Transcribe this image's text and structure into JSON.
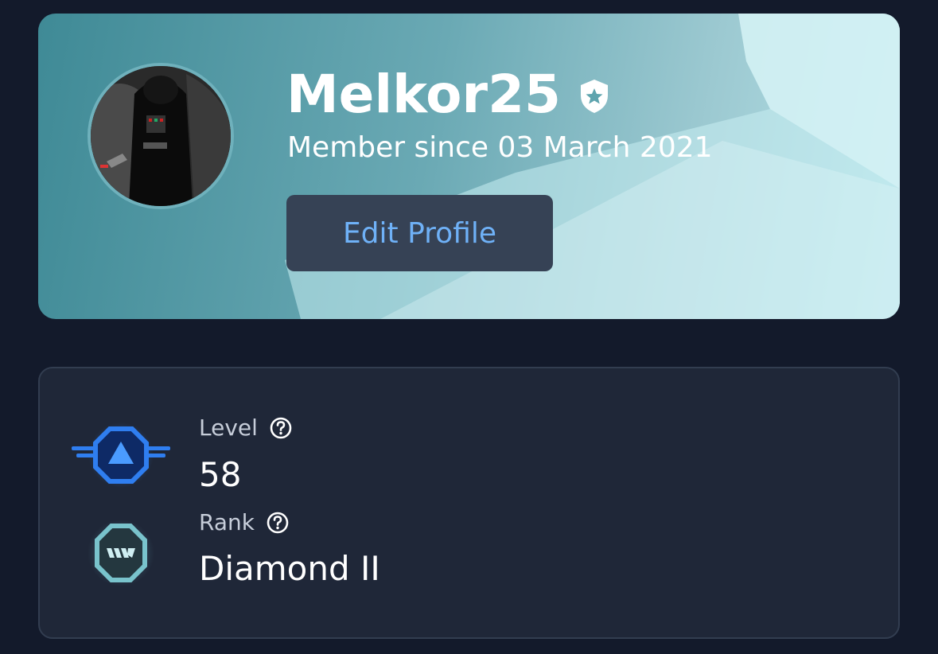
{
  "profile": {
    "username": "Melkor25",
    "member_since": "Member since 03 March 2021",
    "edit_button_label": "Edit Profile",
    "avatar_icon": "dark-helmet-avatar",
    "verified_icon": "shield-star-icon"
  },
  "stats": {
    "level": {
      "label": "Level",
      "value": "58",
      "icon": "level-chevron-badge-icon",
      "help_icon": "question-circle-icon"
    },
    "rank": {
      "label": "Rank",
      "value": "Diamond II",
      "icon": "diamond-rank-badge-icon",
      "help_icon": "question-circle-icon"
    }
  },
  "colors": {
    "page_background": "#131a2b",
    "card_background": "#1f2738",
    "button_background": "#364255",
    "button_text": "#6fb1f7",
    "level_badge": "#2f7ef0",
    "rank_badge": "#79c3cc"
  }
}
